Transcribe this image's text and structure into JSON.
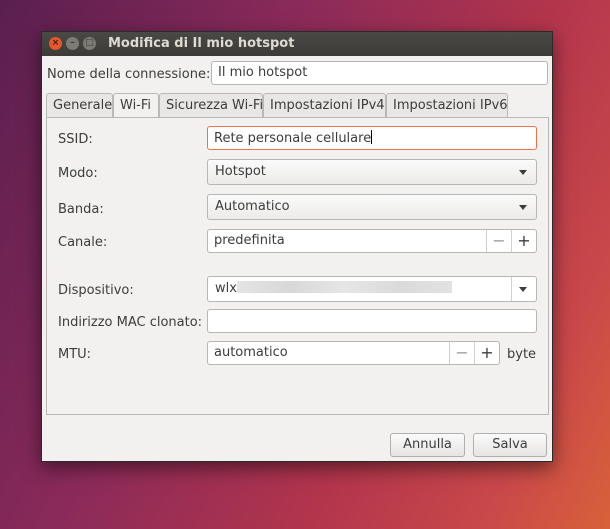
{
  "window": {
    "title": "Modifica di Il mio hotspot",
    "controls": {
      "close": "×",
      "minimize": "–",
      "maximize": "□"
    }
  },
  "connection": {
    "label": "Nome della connessione:",
    "value": "Il mio hotspot"
  },
  "tabs": [
    {
      "label": "Generale",
      "active": false
    },
    {
      "label": "Wi-Fi",
      "active": true
    },
    {
      "label": "Sicurezza Wi-Fi",
      "active": false
    },
    {
      "label": "Impostazioni IPv4",
      "active": false
    },
    {
      "label": "Impostazioni IPv6",
      "active": false
    }
  ],
  "wifi": {
    "ssid": {
      "label": "SSID:",
      "value": "Rete personale cellulare"
    },
    "mode": {
      "label": "Modo:",
      "value": "Hotspot"
    },
    "band": {
      "label": "Banda:",
      "value": "Automatico"
    },
    "channel": {
      "label": "Canale:",
      "value": "predefinita",
      "minus": "−",
      "plus": "+"
    },
    "device": {
      "label": "Dispositivo:",
      "value": "wlx"
    },
    "mac": {
      "label": "Indirizzo MAC clonato:",
      "value": ""
    },
    "mtu": {
      "label": "MTU:",
      "value": "automatico",
      "minus": "−",
      "plus": "+",
      "unit": "byte"
    }
  },
  "buttons": {
    "cancel": "Annulla",
    "save": "Salva"
  },
  "colors": {
    "focus": "#e9754f",
    "titlebar": "#3c3b37",
    "close": "#e4572e"
  }
}
